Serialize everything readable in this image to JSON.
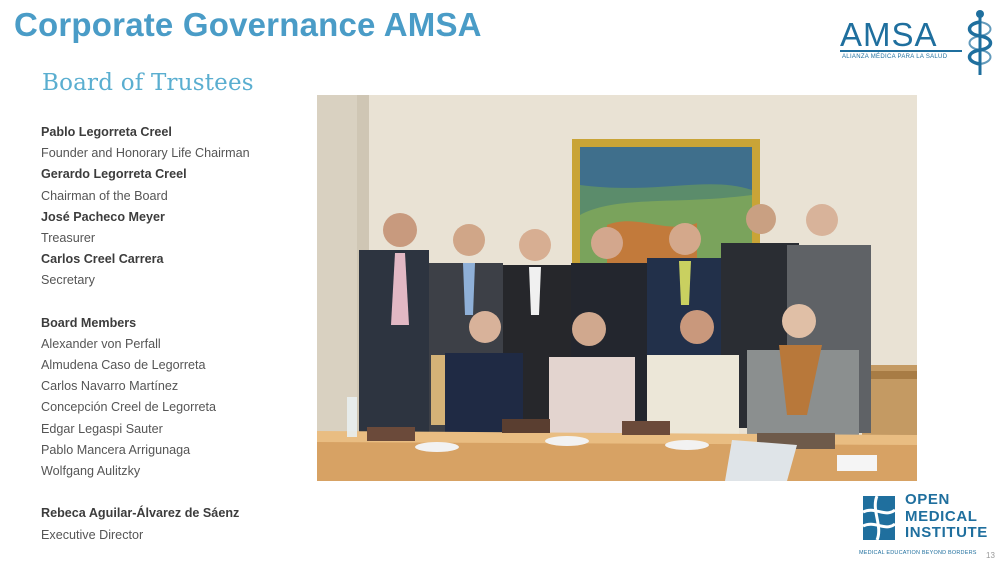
{
  "header": {
    "title": "Corporate Governance AMSA"
  },
  "logo_amsa": {
    "wordmark": "AMSA",
    "tagline": "ALIANZA MÉDICA PARA LA SALUD",
    "brand_color": "#1f6f9e"
  },
  "section": {
    "subtitle": "Board of Trustees"
  },
  "trustees": [
    {
      "name": "Pablo Legorreta Creel",
      "role": "Founder and Honorary Life Chairman"
    },
    {
      "name": "Gerardo Legorreta Creel",
      "role": "Chairman of the Board"
    },
    {
      "name": "José Pacheco Meyer",
      "role": "Treasurer"
    },
    {
      "name": "Carlos Creel Carrera",
      "role": "Secretary"
    }
  ],
  "board_members": {
    "heading": "Board Members",
    "names": [
      "Alexander von Perfall",
      "Almudena Caso de Legorreta",
      "Carlos Navarro Martínez",
      "Concepción Creel de Legorreta",
      "Edgar Legaspi Sauter",
      "Pablo Mancera Arrigunaga",
      "Wolfgang Aulitzky"
    ]
  },
  "executive": {
    "name": "Rebeca Aguilar-Álvarez de Sáenz",
    "role": "Executive Director"
  },
  "logo_omi": {
    "line1": "OPEN",
    "line2": "MEDICAL",
    "line3": "INSTITUTE",
    "tagline": "MEDICAL EDUCATION BEYOND BORDERS"
  },
  "page_number": "13",
  "colors": {
    "title": "#4a9cc7",
    "subtitle": "#5aaed0",
    "text": "#555555"
  }
}
